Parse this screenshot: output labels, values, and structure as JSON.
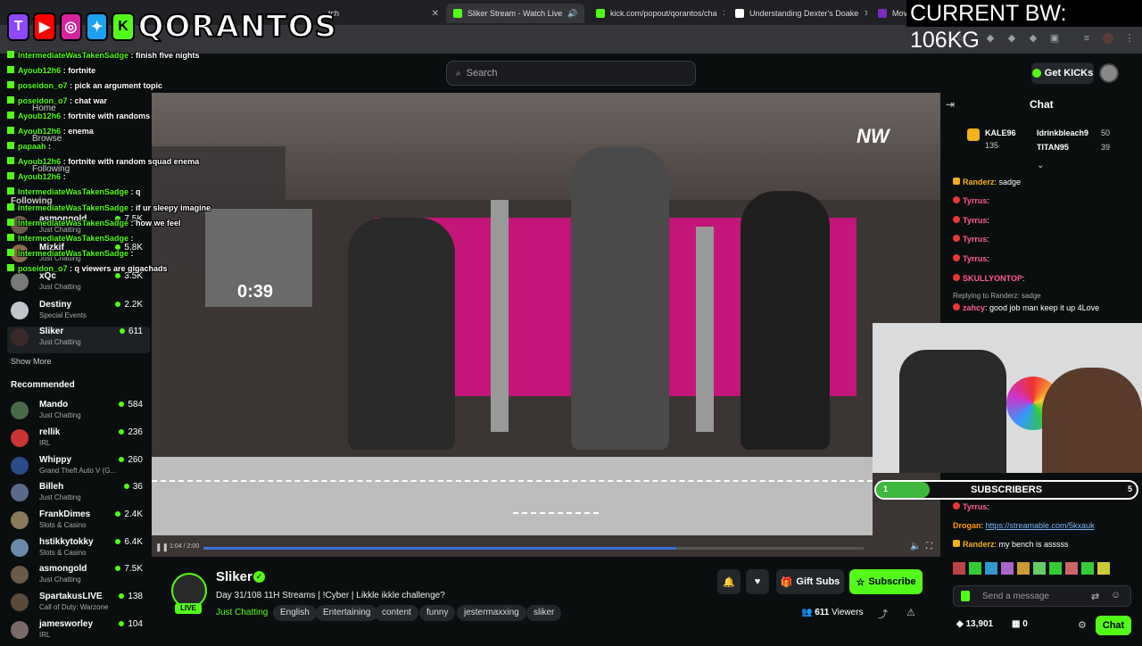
{
  "browser": {
    "tabs": [
      {
        "label": "tch"
      },
      {
        "label": "Sliker Stream - Watch Live"
      },
      {
        "label": "kick.com/popout/qorantos/cha"
      },
      {
        "label": "Understanding Dexter's Doake"
      },
      {
        "label": "Mov"
      }
    ]
  },
  "overlay": {
    "handle": "QORANTOS",
    "bw": "CURRENT BW: 106KG",
    "subs_label": "SUBSCRIBERS",
    "subs_current": "1",
    "subs_goal": "5",
    "timer": "0:39",
    "chat": [
      {
        "user": "IntermediateWasTakenSadge",
        "msg": "finish five nights"
      },
      {
        "user": "Ayoub12h6",
        "msg": "fortnite"
      },
      {
        "user": "poseidon_o7",
        "msg": "pick an argument topic"
      },
      {
        "user": "poseidon_o7",
        "msg": "chat war"
      },
      {
        "user": "Ayoub12h6",
        "msg": "fortnite with randoms"
      },
      {
        "user": "Ayoub12h6",
        "msg": "enema"
      },
      {
        "user": "papaah",
        "msg": ""
      },
      {
        "user": "Ayoub12h6",
        "msg": "fortnite with random squad enema"
      },
      {
        "user": "Ayoub12h6",
        "msg": ""
      },
      {
        "user": "IntermediateWasTakenSadge",
        "msg": "q"
      },
      {
        "user": "IntermediateWasTakenSadge",
        "msg": "if ur sleepy imagine"
      },
      {
        "user": "IntermediateWasTakenSadge",
        "msg": "how we feel"
      },
      {
        "user": "IntermediateWasTakenSadge",
        "msg": ""
      },
      {
        "user": "IntermediateWasTakenSadge",
        "msg": ""
      },
      {
        "user": "poseidon_o7",
        "msg": "q viewers are gigachads"
      }
    ]
  },
  "header": {
    "search_placeholder": "Search",
    "get_kicks": "Get KICKs",
    "nav_home": "Home",
    "nav_browse": "Browse",
    "nav_following": "Following"
  },
  "sidebar": {
    "following_title": "Following",
    "following": [
      {
        "name": "asmongold",
        "cat": "Just Chatting",
        "viewers": "7.5K"
      },
      {
        "name": "Mizkif",
        "cat": "Just Chatting",
        "viewers": "5.8K"
      },
      {
        "name": "xQc",
        "cat": "Just Chatting",
        "viewers": "3.5K"
      },
      {
        "name": "Destiny",
        "cat": "Special Events",
        "viewers": "2.2K"
      },
      {
        "name": "Sliker",
        "cat": "Just Chatting",
        "viewers": "611"
      }
    ],
    "show_more": "Show More",
    "recommended_title": "Recommended",
    "recommended": [
      {
        "name": "Mando",
        "cat": "Just Chatting",
        "viewers": "584"
      },
      {
        "name": "rellik",
        "cat": "IRL",
        "viewers": "236"
      },
      {
        "name": "Whippy",
        "cat": "Grand Theft Auto V (G...",
        "viewers": "260"
      },
      {
        "name": "Billeh",
        "cat": "Just Chatting",
        "viewers": "36"
      },
      {
        "name": "FrankDimes",
        "cat": "Slots & Casino",
        "viewers": "2.4K"
      },
      {
        "name": "hstikkytokky",
        "cat": "Slots & Casino",
        "viewers": "6.4K"
      },
      {
        "name": "asmongold",
        "cat": "Just Chatting",
        "viewers": "7.5K"
      },
      {
        "name": "SpartakusLIVE",
        "cat": "Call of Duty: Warzone",
        "viewers": "138"
      },
      {
        "name": "jamesworley",
        "cat": "IRL",
        "viewers": "104"
      }
    ]
  },
  "video": {
    "time": "1:04 / 2:00",
    "live_badge": "LIVE"
  },
  "stream": {
    "name": "Sliker",
    "title": "Day 31/108 11H Streams | !Cyber | Likkle ikkle challenge?",
    "tags": [
      "Just Chatting",
      "English",
      "Entertaining",
      "content",
      "funny",
      "jestermaxxing",
      "sliker"
    ],
    "gift_label": "Gift Subs",
    "subscribe_label": "Subscribe",
    "viewers": "611",
    "viewers_label": "Viewers"
  },
  "chat": {
    "title": "Chat",
    "leaders": [
      {
        "name": "KALE96",
        "count": "135"
      },
      {
        "name": "Idrinkbleach9",
        "count": "50"
      },
      {
        "name": "TITAN95",
        "count": "39"
      }
    ],
    "messages": [
      {
        "user": "Randerz",
        "msg": "sadge"
      },
      {
        "user": "Tyrrus",
        "msg": ""
      },
      {
        "user": "Tyrrus",
        "msg": ""
      },
      {
        "user": "Tyrrus",
        "msg": ""
      },
      {
        "user": "Tyrrus",
        "msg": ""
      },
      {
        "user": "SKULLYONTOP",
        "msg": ""
      }
    ],
    "reply_to": "Replying to Randerz: sadge",
    "reply_user": "zahcy",
    "reply_msg": "good job man keep it up 4Love",
    "lower_messages": [
      {
        "user": "Tyrrus",
        "msg": ""
      },
      {
        "user": "Drogan",
        "msg": "https://streamable.com/5kxauk"
      },
      {
        "user": "Randerz",
        "msg": "my bench is asssss"
      }
    ],
    "input_placeholder": "Send a message",
    "points": "13,901",
    "gifts": "0",
    "send_label": "Chat"
  }
}
